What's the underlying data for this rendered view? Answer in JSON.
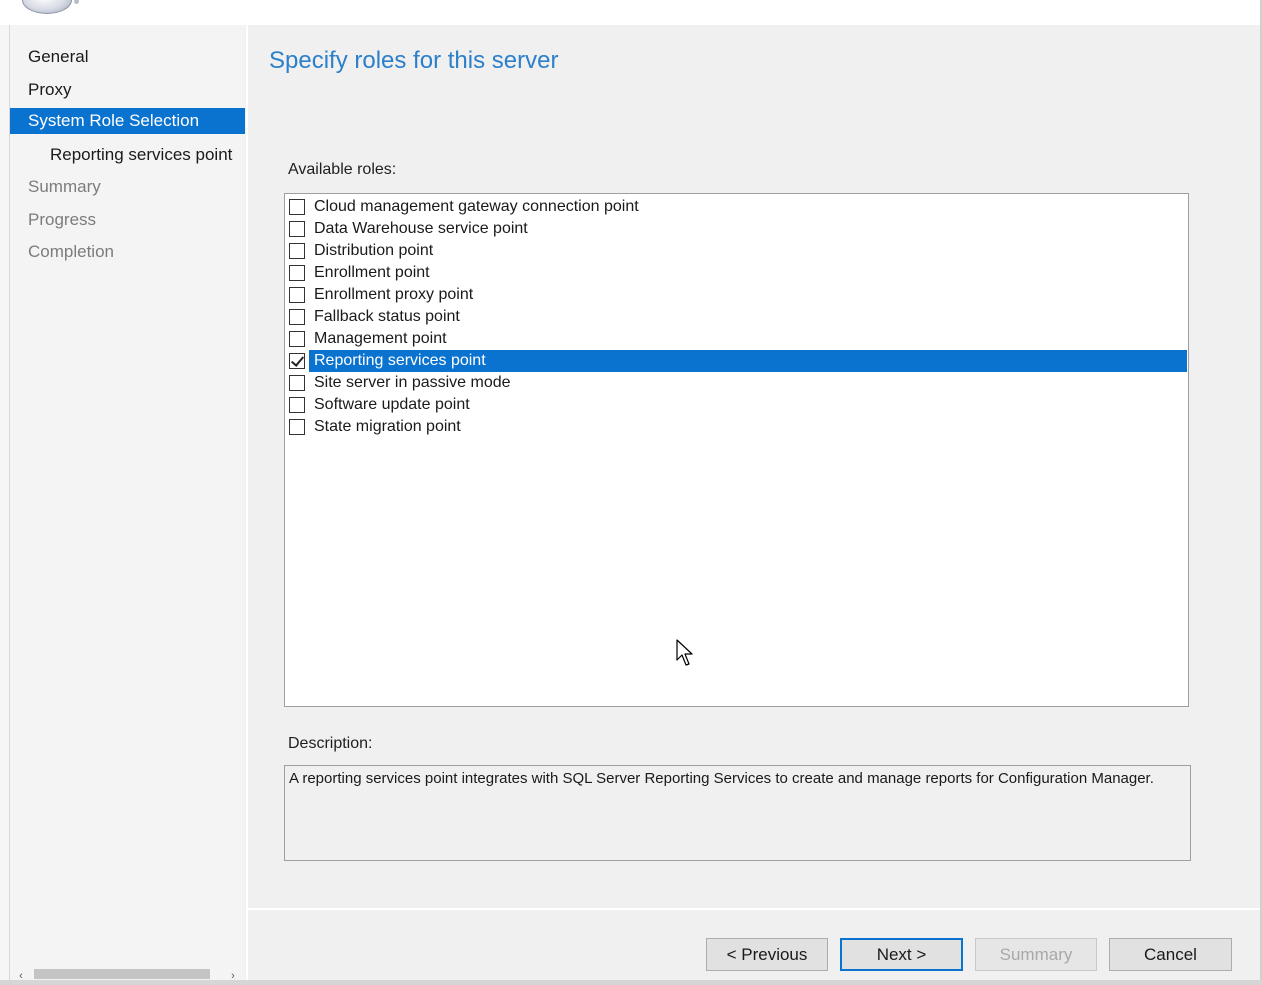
{
  "sidebar": {
    "items": [
      {
        "label": "General",
        "state": "done"
      },
      {
        "label": "Proxy",
        "state": "done"
      },
      {
        "label": "System Role Selection",
        "state": "active"
      },
      {
        "label": "Reporting services point",
        "state": "sub"
      },
      {
        "label": "Summary",
        "state": "pending"
      },
      {
        "label": "Progress",
        "state": "pending"
      },
      {
        "label": "Completion",
        "state": "pending"
      }
    ]
  },
  "main": {
    "title": "Specify roles for this server",
    "roles_label": "Available roles:",
    "roles": [
      {
        "label": "Cloud management gateway connection point",
        "checked": false,
        "selected": false
      },
      {
        "label": "Data Warehouse service point",
        "checked": false,
        "selected": false
      },
      {
        "label": "Distribution point",
        "checked": false,
        "selected": false
      },
      {
        "label": "Enrollment point",
        "checked": false,
        "selected": false
      },
      {
        "label": "Enrollment proxy point",
        "checked": false,
        "selected": false
      },
      {
        "label": "Fallback status point",
        "checked": false,
        "selected": false
      },
      {
        "label": "Management point",
        "checked": false,
        "selected": false
      },
      {
        "label": "Reporting services point",
        "checked": true,
        "selected": true
      },
      {
        "label": "Site server in passive mode",
        "checked": false,
        "selected": false
      },
      {
        "label": "Software update point",
        "checked": false,
        "selected": false
      },
      {
        "label": "State migration point",
        "checked": false,
        "selected": false
      }
    ],
    "description_label": "Description:",
    "description": "A reporting services point integrates with SQL Server Reporting Services to create and manage reports for Configuration Manager."
  },
  "footer": {
    "previous_label": "< Previous",
    "next_label": "Next >",
    "summary_label": "Summary",
    "cancel_label": "Cancel"
  },
  "colors": {
    "accent": "#0a73d0",
    "title": "#2c7fc9"
  }
}
